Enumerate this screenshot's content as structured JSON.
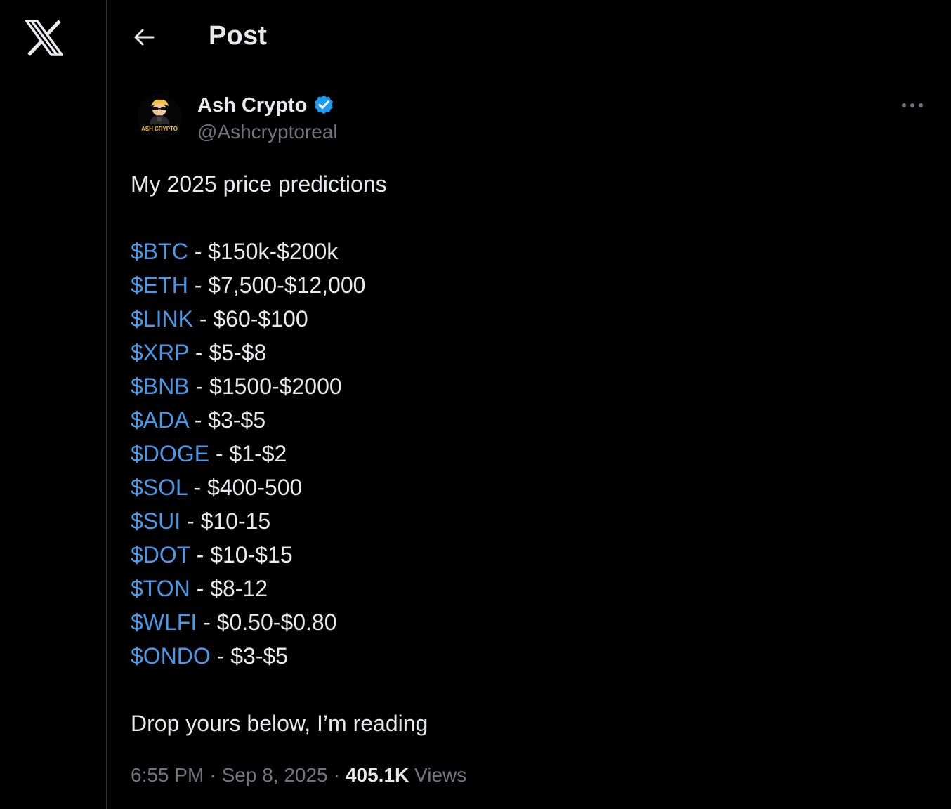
{
  "header": {
    "title": "Post"
  },
  "post": {
    "author": {
      "display_name": "Ash Crypto",
      "handle": "@Ashcryptoreal",
      "verified": true,
      "avatar_label": "ASH CRYPTO"
    },
    "intro": "My 2025 price predictions",
    "predictions": [
      {
        "ticker": "$BTC",
        "range": " - $150k-$200k"
      },
      {
        "ticker": "$ETH",
        "range": " - $7,500-$12,000"
      },
      {
        "ticker": "$LINK",
        "range": " - $60-$100"
      },
      {
        "ticker": "$XRP",
        "range": " - $5-$8"
      },
      {
        "ticker": "$BNB",
        "range": " - $1500-$2000"
      },
      {
        "ticker": "$ADA",
        "range": " - $3-$5"
      },
      {
        "ticker": "$DOGE",
        "range": " - $1-$2"
      },
      {
        "ticker": "$SOL",
        "range": " - $400-500"
      },
      {
        "ticker": "$SUI",
        "range": " - $10-15"
      },
      {
        "ticker": "$DOT",
        "range": " - $10-$15"
      },
      {
        "ticker": "$TON",
        "range": " - $8-12"
      },
      {
        "ticker": "$WLFI",
        "range": " - $0.50-$0.80"
      },
      {
        "ticker": "$ONDO",
        "range": " - $3-$5"
      }
    ],
    "outro": "Drop yours below, I’m reading",
    "time": "6:55 PM",
    "date": "Sep 8, 2025",
    "separator": "·",
    "views_count": "405.1K",
    "views_label": "Views"
  },
  "colors": {
    "background": "#000000",
    "text": "#e7e9ea",
    "muted": "#71767b",
    "cashtag": "#4a99e9",
    "verified_badge": "#1d9bf0",
    "divider": "#2f3336"
  },
  "icons": {
    "logo": "x-logo-icon",
    "back": "arrow-left-icon",
    "verified": "verified-badge-icon",
    "more": "more-horizontal-icon"
  }
}
